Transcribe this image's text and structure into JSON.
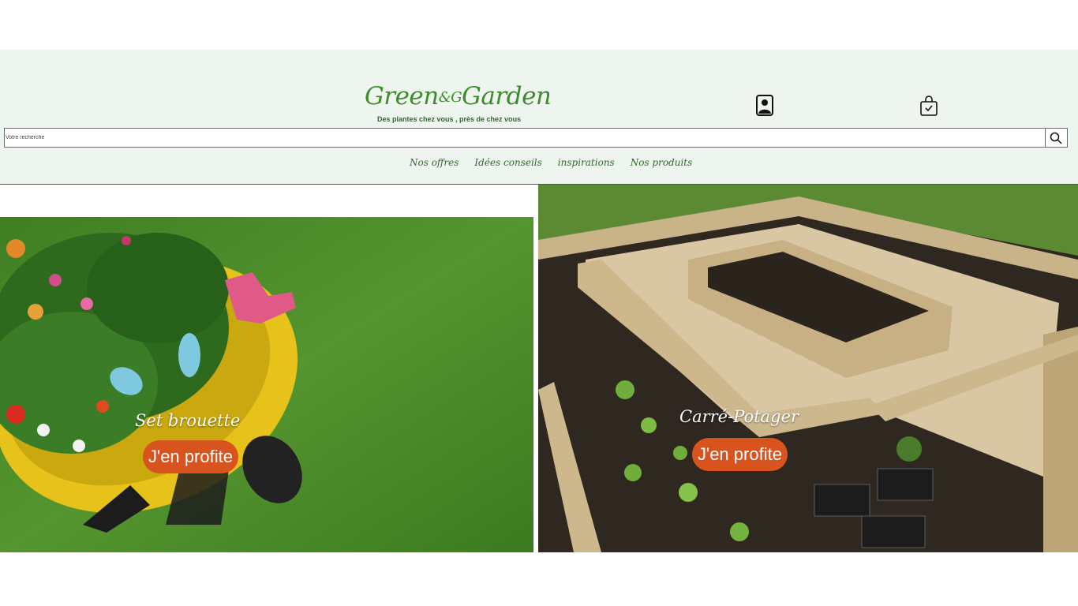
{
  "header": {
    "logo": {
      "part1": "Green",
      "amp": "&G",
      "part2": "Garden"
    },
    "tagline": "Des plantes chez vous , près de chez vous",
    "account_icon": "user-profile-icon",
    "cart_icon": "shopping-bag-icon"
  },
  "search": {
    "placeholder": "Votre recherche",
    "button_icon": "search-icon"
  },
  "nav": {
    "items": [
      "Nos offres",
      "Idées conseils",
      "inspirations",
      "Nos produits"
    ]
  },
  "promos": [
    {
      "title": "Set brouette",
      "cta": "J'en profite"
    },
    {
      "title": "Carré-Potager",
      "cta": "J'en profite"
    }
  ],
  "colors": {
    "header_bg": "#eef4ee",
    "brand_green": "#3f8a2e",
    "cta_orange": "#d9531e"
  }
}
